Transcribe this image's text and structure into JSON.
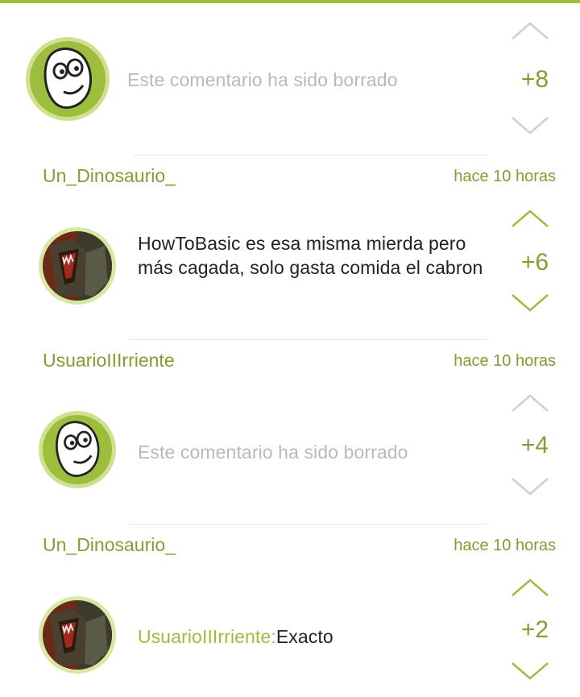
{
  "colors": {
    "accent": "#9dbd3d",
    "accent_dark": "#7f9f33",
    "muted": "#b9b9b9",
    "divider": "#e6e6e6"
  },
  "comments": [
    {
      "avatar_icon": "smiley-icon",
      "text": "Este comentario ha sido borrado",
      "score": "+8",
      "deleted": true
    },
    {
      "author": "Un_Dinosaurio_",
      "time": "hace 10 horas",
      "avatar_icon": "dinosaur-avatar",
      "text": "HowToBasic es esa misma mierda pero más cagada, solo gasta comida el cabron",
      "score": "+6",
      "deleted": false
    },
    {
      "author": "UsuarioIIIrriente",
      "time": "hace 10 horas",
      "avatar_icon": "smiley-icon",
      "text": "Este comentario ha sido borrado",
      "score": "+4",
      "deleted": true
    },
    {
      "author": "Un_Dinosaurio_",
      "time": "hace 10 horas",
      "avatar_icon": "dinosaur-avatar",
      "mention": "UsuarioIIIrriente:",
      "text": "Exacto",
      "score": "+2",
      "deleted": false
    }
  ]
}
